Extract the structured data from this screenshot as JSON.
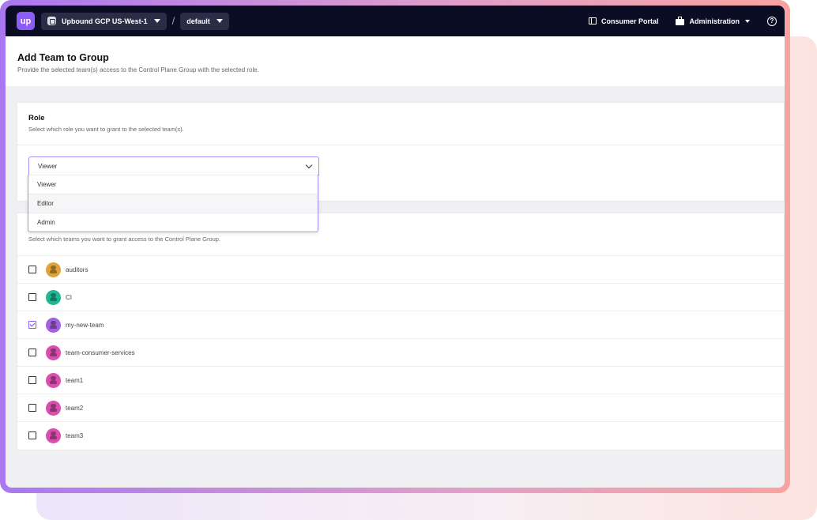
{
  "topbar": {
    "logo_text": "up",
    "context": "Upbound GCP US-West-1",
    "separator": "/",
    "namespace": "default",
    "consumer_portal": "Consumer Portal",
    "administration": "Administration",
    "help_glyph": "?"
  },
  "page": {
    "title": "Add Team to Group",
    "subtitle": "Provide the selected team(s) access to the Control Plane Group with the selected role."
  },
  "role": {
    "title": "Role",
    "subtitle": "Select which role you want to grant to the selected team(s).",
    "selected": "Viewer",
    "options": [
      "Viewer",
      "Editor",
      "Admin"
    ]
  },
  "teams": {
    "subtitle": "Select which teams you want to grant access to the Control Plane Group.",
    "items": [
      {
        "name": "auditors",
        "checked": false,
        "color": "#e0a33a"
      },
      {
        "name": "CI",
        "checked": false,
        "color": "#1fb892"
      },
      {
        "name": "my-new-team",
        "checked": true,
        "color": "#a461e0"
      },
      {
        "name": "team-consumer-services",
        "checked": false,
        "color": "#d94fae"
      },
      {
        "name": "team1",
        "checked": false,
        "color": "#d94fae"
      },
      {
        "name": "team2",
        "checked": false,
        "color": "#d94fae"
      },
      {
        "name": "team3",
        "checked": false,
        "color": "#d94fae"
      }
    ]
  }
}
